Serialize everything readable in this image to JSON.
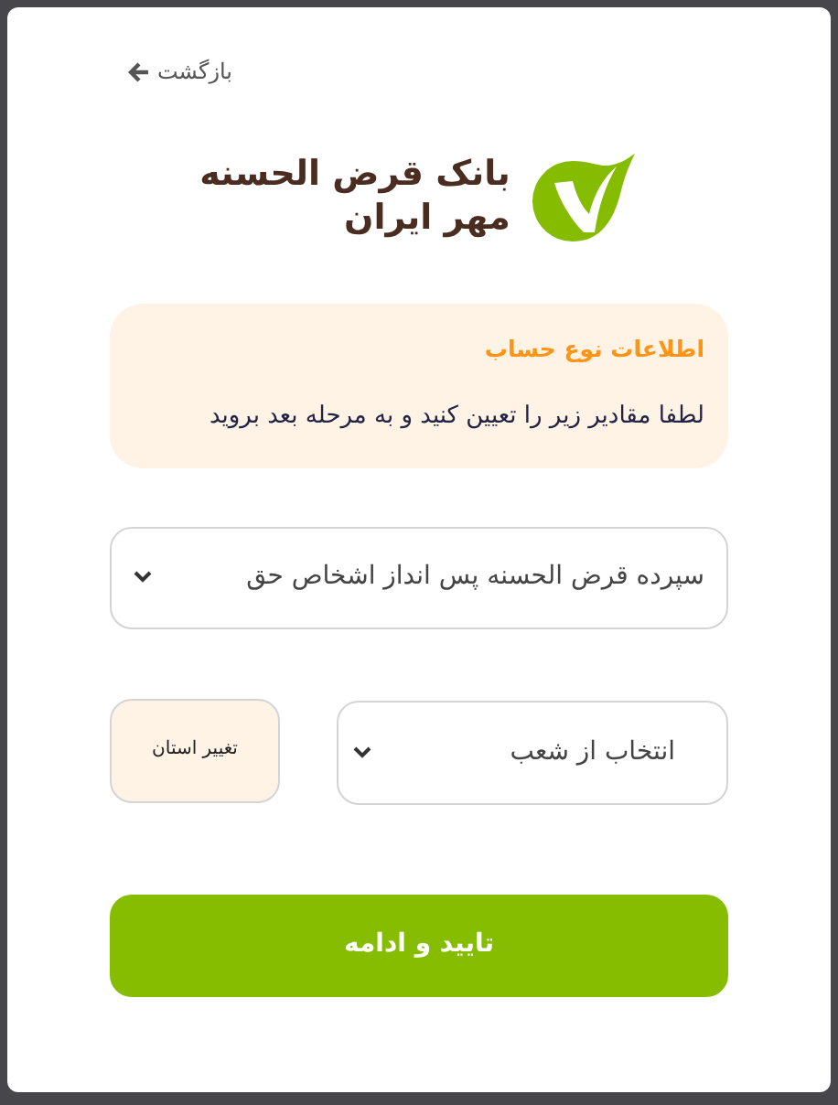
{
  "back_link": {
    "label": "بازگشت"
  },
  "logo": {
    "line_1": "بانک قرض الحسنه",
    "line_2": "مهر ایران"
  },
  "info": {
    "title": "اطلاعات نوع حساب",
    "text": "لطفا مقادیر زیر را تعیین کنید و به مرحله بعد بروید"
  },
  "account_type_select": {
    "value": "سپرده قرض الحسنه پس انداز اشخاص حق"
  },
  "branch_select": {
    "value": "انتخاب از شعب"
  },
  "change_province_button": {
    "label": "تغییر استان"
  },
  "submit_button": {
    "label": "تایید و ادامه"
  }
}
